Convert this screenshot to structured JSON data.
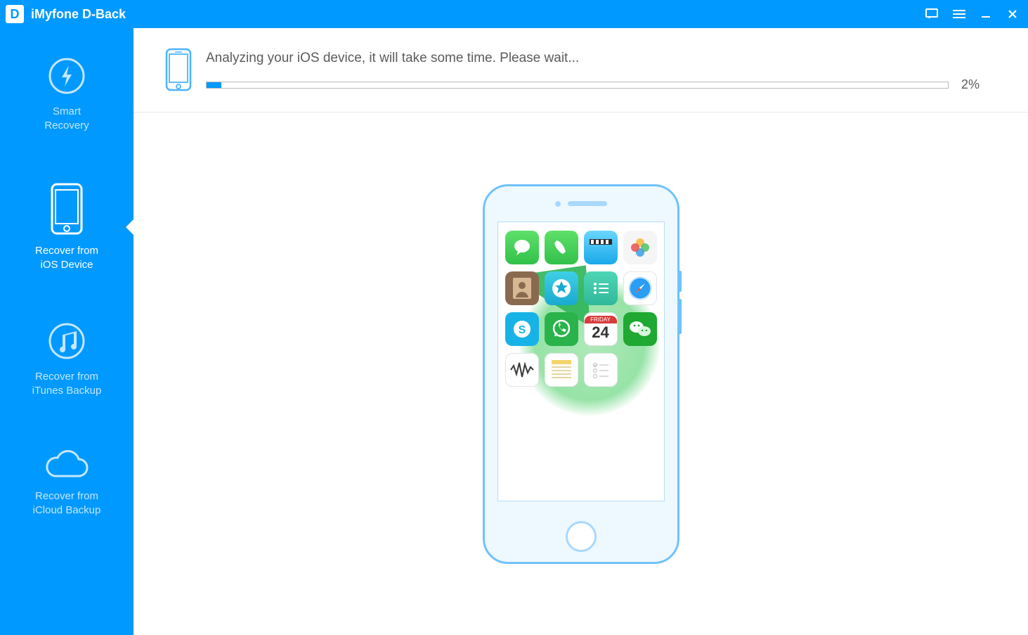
{
  "titlebar": {
    "logo_letter": "D",
    "app_name": "iMyfone D-Back"
  },
  "sidebar": {
    "items": [
      {
        "label": "Smart\nRecovery"
      },
      {
        "label": "Recover from\niOS Device"
      },
      {
        "label": "Recover from\niTunes Backup"
      },
      {
        "label": "Recover from\niCloud Backup"
      }
    ],
    "active_index": 1
  },
  "progress": {
    "status_text": "Analyzing your iOS device, it will take some time. Please wait...",
    "percent": 2,
    "percent_label": "2%"
  },
  "phone_apps": [
    "messages",
    "phone",
    "videos",
    "photos",
    "contacts",
    "app-store",
    "notes",
    "safari",
    "skype",
    "whatsapp",
    "calendar",
    "wechat",
    "voice-memos",
    "reminders",
    "checklist"
  ],
  "calendar_day": "24"
}
